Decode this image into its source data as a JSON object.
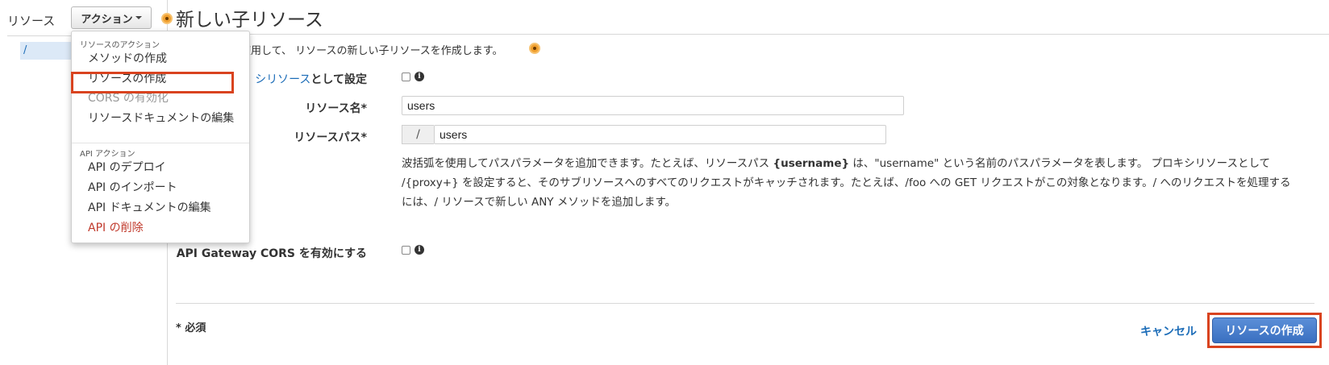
{
  "sidebar": {
    "title": "リソース",
    "actions_label": "アクション",
    "tree": [
      {
        "label": "/"
      }
    ]
  },
  "menu": {
    "sections": [
      {
        "header": "リソースのアクション",
        "items": [
          {
            "label": "メソッドの作成",
            "state": "normal"
          },
          {
            "label": "リソースの作成",
            "state": "highlighted"
          },
          {
            "label": "CORS の有効化",
            "state": "disabled"
          },
          {
            "label": "リソースドキュメントの編集",
            "state": "normal"
          }
        ]
      },
      {
        "header": "API アクション",
        "items": [
          {
            "label": "API のデプロイ",
            "state": "normal"
          },
          {
            "label": "API のインポート",
            "state": "normal"
          },
          {
            "label": "API ドキュメントの編集",
            "state": "normal"
          },
          {
            "label": "API の削除",
            "state": "danger"
          }
        ]
      }
    ]
  },
  "main": {
    "title": "新しい子リソース",
    "description": "使用して、 リソースの新しい子リソースを作成します。",
    "proxy_label_link": "シリソース",
    "proxy_label_rest": "として設定",
    "resource_name_label": "リソース名*",
    "resource_name_value": "users",
    "resource_path_label": "リソースパス*",
    "resource_path_prefix": "/",
    "resource_path_value": "users",
    "help_line1_a": "波括弧を使用してパスパラメータを追加できます。たとえば、リソースパス ",
    "help_line1_bold": "{username}",
    "help_line1_b": " は、\"username\" という名前のパスパラメータを表します。 プロキシリソースとして",
    "help_line2": "/{proxy+} を設定すると、そのサブリソースへのすべてのリクエストがキャッチされます。たとえば、/foo への GET リクエストがこの対象となります。/ へのリクエストを処理する",
    "help_line3": "には、/ リソースで新しい ANY メソッドを追加します。",
    "cors_label": "API Gateway CORS を有効にする",
    "required_note": "* 必須",
    "cancel_label": "キャンセル",
    "create_label": "リソースの作成"
  },
  "colors": {
    "accent": "#1d6db8",
    "highlight_box": "#d9431f",
    "primary_button": "#3a6fc0",
    "danger": "#c0392b"
  }
}
